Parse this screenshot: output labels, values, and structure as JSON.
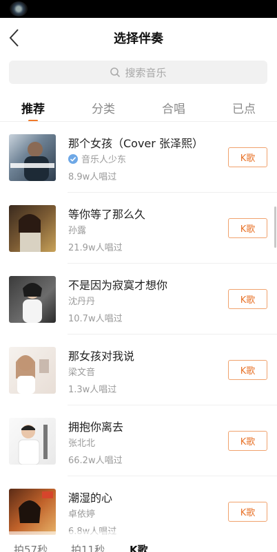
{
  "header": {
    "title": "选择伴奏"
  },
  "search": {
    "placeholder": "搜索音乐"
  },
  "tabs": [
    {
      "label": "推荐",
      "active": true
    },
    {
      "label": "分类",
      "active": false
    },
    {
      "label": "合唱",
      "active": false
    },
    {
      "label": "已点",
      "active": false
    }
  ],
  "songs": [
    {
      "title": "那个女孩（Cover 张泽熙）",
      "artist": "音乐人少东",
      "verified": true,
      "count": "8.9w人唱过",
      "button": "K歌"
    },
    {
      "title": "等你等了那么久",
      "artist": "孙露",
      "verified": false,
      "count": "21.9w人唱过",
      "button": "K歌"
    },
    {
      "title": "不是因为寂寞才想你",
      "artist": "沈丹丹",
      "verified": false,
      "count": "10.7w人唱过",
      "button": "K歌"
    },
    {
      "title": "那女孩对我说",
      "artist": "梁文音",
      "verified": false,
      "count": "1.3w人唱过",
      "button": "K歌"
    },
    {
      "title": "拥抱你离去",
      "artist": "张北北",
      "verified": false,
      "count": "66.2w人唱过",
      "button": "K歌"
    },
    {
      "title": "潮湿的心",
      "artist": "卓依婷",
      "verified": false,
      "count": "6.8w人唱过",
      "button": "K歌"
    }
  ],
  "bottom_tabs": [
    {
      "label": "拍57秒",
      "active": false
    },
    {
      "label": "拍11秒",
      "active": false
    },
    {
      "label": "K歌",
      "active": true
    }
  ],
  "colors": {
    "accent": "#f07a2a",
    "button_text": "#e8742b",
    "verified_badge": "#6ea8e6"
  }
}
